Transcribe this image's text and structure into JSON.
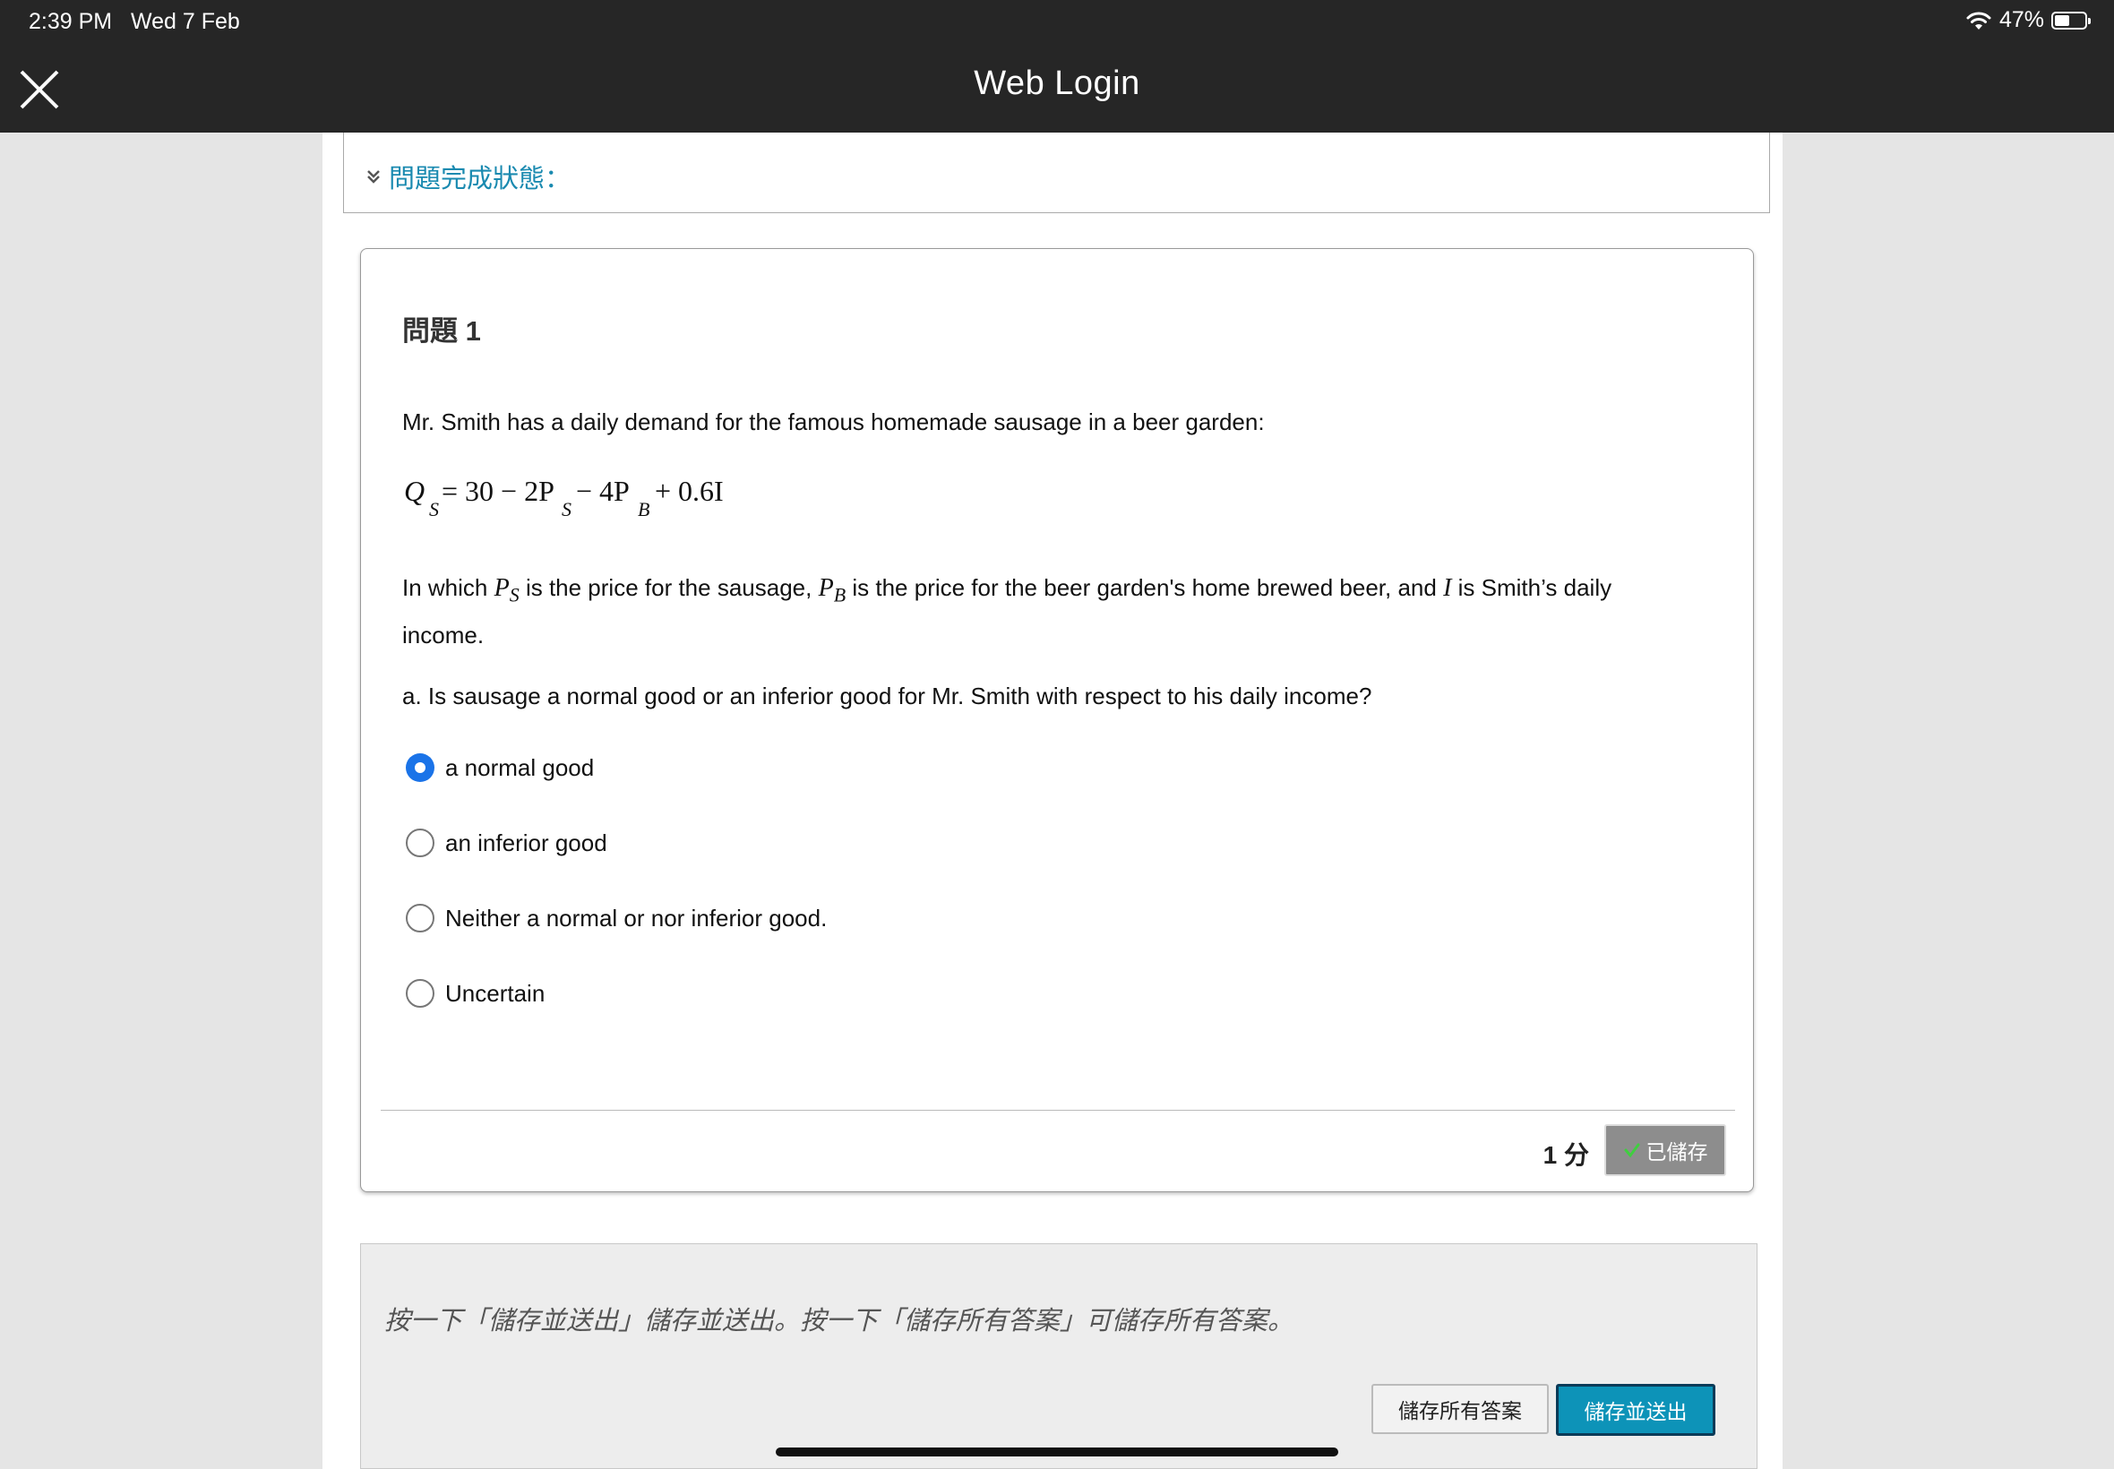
{
  "status_bar": {
    "time": "2:39 PM",
    "date": "Wed 7 Feb",
    "battery": "47%"
  },
  "top_bar": {
    "title": "Web Login"
  },
  "completion_status": {
    "label": "問題完成狀態："
  },
  "question": {
    "title": "問題 1",
    "intro": "Mr. Smith has a daily demand for the famous homemade sausage in a beer garden:",
    "formula": {
      "q": "Q",
      "q_sub": "S",
      "eq": "= 30 − 2P",
      "p_sub": "S",
      "minus": "− 4P",
      "b_sub": "B",
      "rest": "+ 0.6I"
    },
    "text": {
      "part1": "In which ",
      "ps": "P",
      "ps_sub": "S",
      "part2": " is the price for the sausage, ",
      "pb": "P",
      "pb_sub": "B",
      "part3": " is the price for the beer garden's home brewed beer, and ",
      "i": "I",
      "part4": " is Smith’s daily income."
    },
    "prompt": "a. Is sausage a normal good or an inferior good for Mr. Smith with respect to his daily income?",
    "options": [
      {
        "label": "a normal good",
        "selected": true
      },
      {
        "label": "an inferior good",
        "selected": false
      },
      {
        "label": "Neither a normal or nor inferior good.",
        "selected": false
      },
      {
        "label": "Uncertain",
        "selected": false
      }
    ],
    "points": "1 分",
    "saved_label": "已儲存"
  },
  "submit_panel": {
    "instructions": "按一下「儲存並送出」儲存並送出。按一下「儲存所有答案」可儲存所有答案。",
    "save_all_label": "儲存所有答案",
    "submit_label": "儲存並送出"
  },
  "colors": {
    "accent": "#0d93b8",
    "link": "#1a8ab0",
    "radio_selected": "#1a73e8",
    "header_bg": "#262626"
  }
}
